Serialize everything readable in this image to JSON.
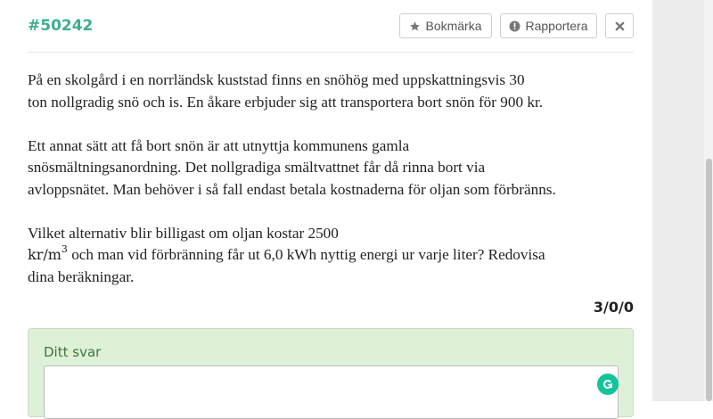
{
  "problem": {
    "id": "#50242",
    "points": "3/0/0"
  },
  "toolbar": {
    "bookmark_label": "Bokmärka",
    "bookmark_icon": "star-icon",
    "report_label": "Rapportera",
    "report_icon": "exclamation-circle-icon",
    "close_icon": "close-icon"
  },
  "question": {
    "p1_l1": "På en skolgård i en norrländsk kuststad finns en snöhög med uppskattningsvis 30",
    "p1_l2": "ton nollgradig snö och is. En åkare erbjuder sig att transportera bort snön för 900 kr.",
    "p2_l1": "Ett annat sätt att få bort snön är att utnyttja kommunens gamla",
    "p2_l2": "snösmältningsanordning. Det nollgradiga smältvattnet får då rinna bort via",
    "p2_l3": "avloppsnätet. Man behöver i så fall endast betala kostnaderna för oljan som förbränns.",
    "p3_l1": "Vilket alternativ blir billigast om oljan kostar 2500",
    "p3_unit": "kr/m",
    "p3_unit_exp": "3",
    "p3_l2_rest": " och man vid förbränning får ut 6,0 kWh nyttig energi ur varje liter? Redovisa",
    "p3_l3": "dina beräkningar."
  },
  "answer": {
    "label": "Ditt svar",
    "value": ""
  },
  "colors": {
    "accent": "#3fae92",
    "answer_bg": "#dff0d8",
    "grammarly": "#15c39a"
  }
}
